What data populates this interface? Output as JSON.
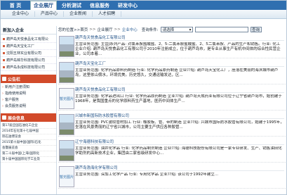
{
  "topnav": {
    "tabs": [
      "首 页",
      "企业展厅",
      "分析测试",
      "信息服务",
      "研发中心"
    ],
    "active_index": 1
  },
  "subnav": {
    "items": [
      "企业中心",
      "产品中心",
      "企业新闻",
      "人才招聘"
    ]
  },
  "sidebar": {
    "new_join_title": "新加入企业",
    "new_join": [
      "葫芦岛天悦食品化工有限公",
      "葫芦岛天宝化工厂",
      "沈阳五林实业有限公司",
      "葫芦岛锦华科技有限公司",
      "葫芦岛永成科技有限公司"
    ],
    "notice_title": "公告栏",
    "notices": [
      "新用户注册须知",
      "指南使用说明",
      "客户服务",
      "会员服务说明"
    ],
    "news_title": "展会信息",
    "news": [
      "第17届全国石油化工企业",
      "2014年石化第十七届中国",
      "际石油博览会",
      "2015第十届中国(国际)石化",
      "会暨展览会",
      "第二十届中国(上海)国际化",
      "第十届中国国际化学工业及"
    ]
  },
  "main": {
    "breadcrumb": {
      "prefix": "您的位置>>",
      "home": "首页",
      "mid": "企业展厅",
      "current": "企业中心"
    },
    "search": {
      "label": "查询条件:",
      "field": "请选择",
      "button": "查询"
    },
    "records": [
      {
        "name": "葫芦岛天悦食品化工有限公司",
        "desc": "主营业务范围: 主营J系列产品: 对氯苯胺盐酸盐、2、5-二氯苯胺盐酸盐、2、5二氯苯胺、产品的生产和销售。行业: 化工 企业介绍: 葫芦岛天悦食品化工有限公司于2010年注册成立，位于葫芦岛市，是专业从事生产有机中间体的综合性民营企业，公司本着...",
        "thumb": "photo"
      },
      {
        "name": "葫芦岛天宝化工厂",
        "desc": "主营业务范围: 化学药品原料药制造 行业: 化学药品原药制造 企业介绍: 葫芦岛天宝化工厂，座落在美丽的海滨城市葫芦岛，这里依山傍水，环境优美。历史悠久，交通运输发达，区...",
        "thumb": "photo"
      },
      {
        "name": "葫芦岛天悦食品化工有限公司",
        "desc": "主营业务范围: 化学品进出口 行业: 化学药品原药制造 企业介绍: 葫芦岛天成药业有限公司位于辽宁省葫芦岛市，始创建于1968年，是我国重点的化学原料药生产基地，医药中间体生产...",
        "thumb": "placeholder"
      },
      {
        "name": "兴城市新国际防水胶管有限公司",
        "desc": "主营业务范围: PVC波纹管材加工 行业: 橡胶板、管、带的制造 企业介绍: 兴城市国际防水胶管有限公司，始建于1995年，坐落在风景秀丽的辽宁省兴城市，公司主要生产供应各种胶管...",
        "thumb": "photo"
      },
      {
        "name": "辽宁海德科技有限公司",
        "desc": "主营业务范围: 油井化学品 行业: 化学药品制剂制造 企业介绍: 海德科技股份有限公司是一家专业研发、生产、销售油田化学助剂的高新技术企业，集团由二家省级研发中心...",
        "thumb": "photo"
      },
      {
        "name": "葫芦岛渤海化学有限公司",
        "desc": "主营业务范围: 深加工化学产品 行业: 专用化学品 企业介绍: 该公司于1992年建立...",
        "thumb": "placeholder"
      }
    ],
    "placeholder_text": "暂无图片"
  }
}
